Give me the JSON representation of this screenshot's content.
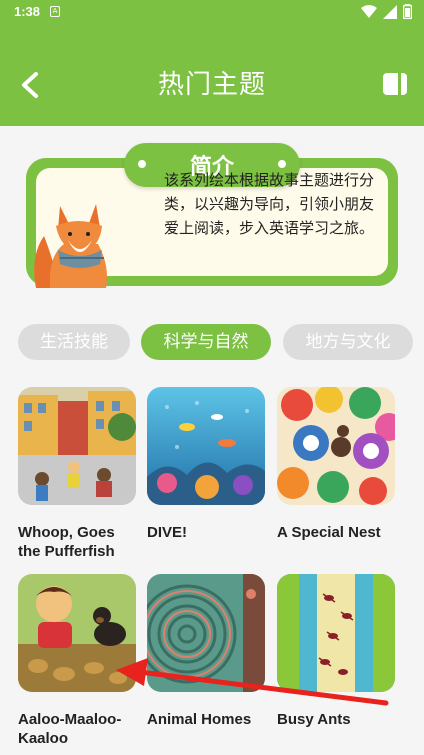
{
  "status": {
    "time": "1:38",
    "sim_glyph": "A"
  },
  "header": {
    "title": "热门主题"
  },
  "intro": {
    "label": "简介",
    "text": "该系列绘本根据故事主题进行分类，以兴趣为导向，引领小朋友爱上阅读，步入英语学习之旅。"
  },
  "tabs": [
    {
      "label": "生活技能",
      "active": false
    },
    {
      "label": "科学与自然",
      "active": true
    },
    {
      "label": "地方与文化",
      "active": false
    }
  ],
  "books": [
    {
      "title": "Whoop, Goes the Pufferfish"
    },
    {
      "title": "DIVE!"
    },
    {
      "title": "A Special Nest"
    },
    {
      "title": "Aaloo-Maaloo-Kaaloo"
    },
    {
      "title": "Animal Homes"
    },
    {
      "title": "Busy Ants"
    }
  ],
  "colors": {
    "primary": "#7dc142",
    "tab_inactive": "#dcdcdc",
    "annotation_arrow": "#e8221c"
  }
}
